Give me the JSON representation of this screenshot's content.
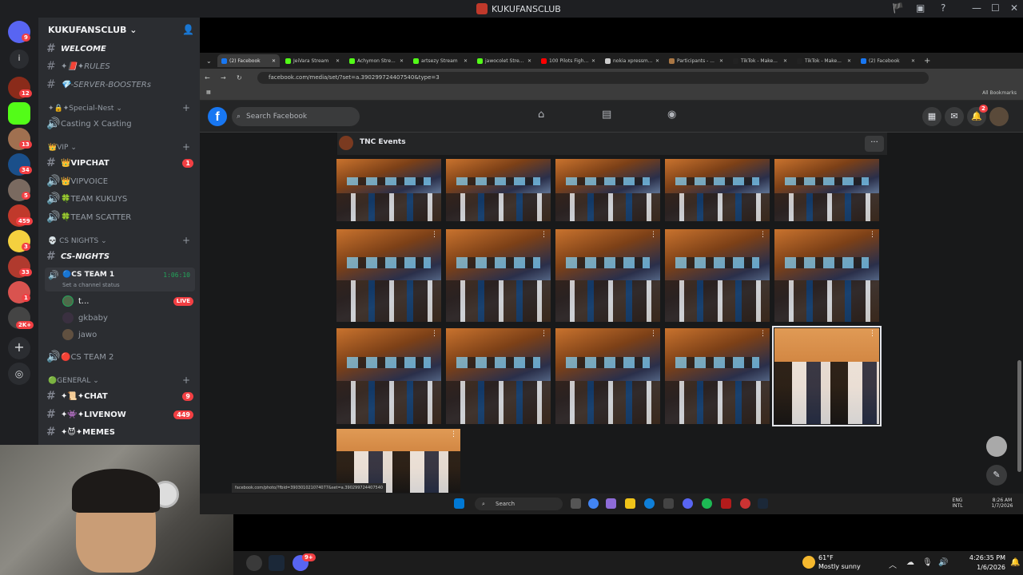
{
  "window": {
    "title": "KUKUFANSCLUB",
    "controls": [
      "🏴",
      "▣",
      "?",
      "—",
      "☐",
      "✕"
    ]
  },
  "servers": {
    "badges": [
      "9",
      "12",
      "13",
      "34",
      "5",
      "459",
      "3",
      "33",
      "1",
      "2K+"
    ]
  },
  "sidebar": {
    "server_name": "KUKUFANSCLUB",
    "items": [
      {
        "label": "WELCOME",
        "style": "bold-italic"
      },
      {
        "label": "✦📕✦RULES",
        "style": "italic"
      },
      {
        "label": "💎-SERVER-BOOSTERs",
        "style": "italic"
      },
      {
        "label": "✦🔒✦Special-Nest",
        "type": "category"
      },
      {
        "label": "Casting X Casting",
        "type": "voice"
      },
      {
        "label": "👑VIP",
        "type": "category"
      },
      {
        "label": "👑VIPCHAT",
        "badge": "1"
      },
      {
        "label": "👑VIPVOICE",
        "type": "voice"
      },
      {
        "label": "🍀TEAM KUKUYS",
        "type": "voice"
      },
      {
        "label": "🍀TEAM SCATTER",
        "type": "voice"
      },
      {
        "label": "💀 CS NIGHTS",
        "type": "category"
      },
      {
        "label": "CS-NIGHTS",
        "style": "bold-italic"
      },
      {
        "label": "🔵CS TEAM 1",
        "type": "voice",
        "timer": "1:06:10",
        "status": "Set a channel status"
      },
      {
        "label": "t...",
        "type": "member",
        "live": "LIVE"
      },
      {
        "label": "gkbaby",
        "type": "member"
      },
      {
        "label": "jawo",
        "type": "member"
      },
      {
        "label": "🔴CS TEAM 2",
        "type": "voice"
      },
      {
        "label": "🟢GENERAL",
        "type": "category"
      },
      {
        "label": "✦📜✦CHAT",
        "badge": "9"
      },
      {
        "label": "✦👾✦LIVENOW",
        "badge": "449"
      },
      {
        "label": "✦😈✦MEMES"
      }
    ]
  },
  "browser": {
    "tabs": [
      {
        "label": "(2) Facebook",
        "color": "#1877f2",
        "active": true
      },
      {
        "label": "JeiVara Stream",
        "color": "#53fc18"
      },
      {
        "label": "Achymon Stre...",
        "color": "#53fc18"
      },
      {
        "label": "artsezy Stream",
        "color": "#53fc18"
      },
      {
        "label": "jawocolet Stre...",
        "color": "#53fc18"
      },
      {
        "label": "100 Pilots Figh...",
        "color": "#ff0000"
      },
      {
        "label": "nokia xpressm...",
        "color": "#cccccc"
      },
      {
        "label": "Participants - ...",
        "color": "#aa7744"
      },
      {
        "label": "TikTok - Make...",
        "color": "#222222"
      },
      {
        "label": "TikTok - Make...",
        "color": "#222222"
      },
      {
        "label": "(2) Facebook",
        "color": "#1877f2"
      }
    ],
    "url": "facebook.com/media/set/?set=a.390299724407540&type=3",
    "bookmarks_label": "All Bookmarks",
    "status_url": "facebook.com/photo/?fbid=390301021074077&set=a.390299724407540"
  },
  "facebook": {
    "search_placeholder": "Search Facebook",
    "notifications": "2",
    "album_page": "TNC Events",
    "more": "···"
  },
  "inner_taskbar": {
    "search": "Search",
    "lang": "ENG",
    "lang2": "INTL",
    "time": "8:26 AM",
    "date": "1/7/2026"
  },
  "taskbar": {
    "weather_temp": "61°F",
    "weather_desc": "Mostly sunny",
    "time": "4:26:35 PM",
    "date": "1/6/2026",
    "badge": "9+"
  }
}
